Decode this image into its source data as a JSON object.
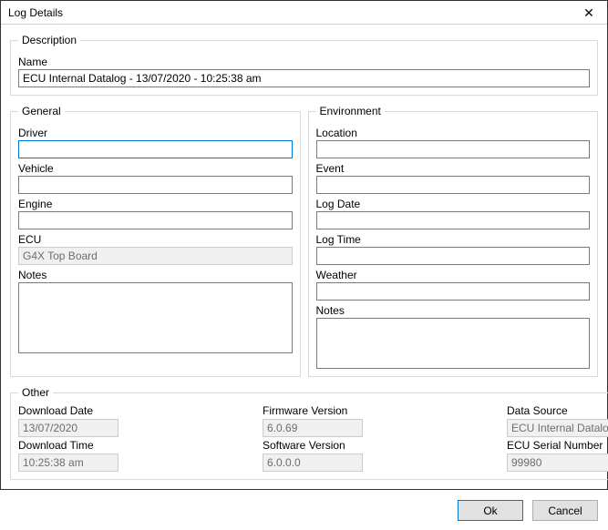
{
  "window": {
    "title": "Log Details"
  },
  "description": {
    "legend": "Description",
    "name_label": "Name",
    "name_value": "ECU Internal Datalog - 13/07/2020 - 10:25:38 am"
  },
  "general": {
    "legend": "General",
    "driver_label": "Driver",
    "driver_value": "",
    "vehicle_label": "Vehicle",
    "vehicle_value": "",
    "engine_label": "Engine",
    "engine_value": "",
    "ecu_label": "ECU",
    "ecu_value": "G4X Top Board",
    "notes_label": "Notes",
    "notes_value": ""
  },
  "environment": {
    "legend": "Environment",
    "location_label": "Location",
    "location_value": "",
    "event_label": "Event",
    "event_value": "",
    "log_date_label": "Log Date",
    "log_date_value": "",
    "log_time_label": "Log Time",
    "log_time_value": "",
    "weather_label": "Weather",
    "weather_value": "",
    "notes_label": "Notes",
    "notes_value": ""
  },
  "other": {
    "legend": "Other",
    "download_date_label": "Download Date",
    "download_date_value": "13/07/2020",
    "download_time_label": "Download Time",
    "download_time_value": "10:25:38 am",
    "firmware_version_label": "Firmware Version",
    "firmware_version_value": "6.0.69",
    "software_version_label": "Software Version",
    "software_version_value": "6.0.0.0",
    "data_source_label": "Data Source",
    "data_source_value": "ECU Internal Datalog",
    "ecu_serial_label": "ECU Serial Number",
    "ecu_serial_value": "99980"
  },
  "buttons": {
    "ok": "Ok",
    "cancel": "Cancel"
  }
}
